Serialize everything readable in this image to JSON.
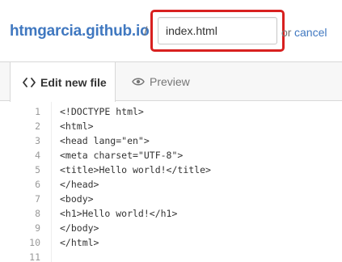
{
  "header": {
    "repo_name": "htmgarcia.github.io",
    "separator": "/",
    "filename_value": "index.html",
    "or_text": "or",
    "cancel_label": "cancel"
  },
  "tabs": [
    {
      "label": "Edit new file",
      "icon": "code-icon",
      "active": true
    },
    {
      "label": "Preview",
      "icon": "eye-icon",
      "active": false
    }
  ],
  "editor": {
    "line_numbers": [
      "1",
      "2",
      "3",
      "4",
      "5",
      "6",
      "7",
      "8",
      "9",
      "10",
      "11"
    ],
    "lines": [
      "<!DOCTYPE html>",
      "<html>",
      "<head lang=\"en\">",
      "<meta charset=\"UTF-8\">",
      "<title>Hello world!</title>",
      "</head>",
      "<body>",
      "<h1>Hello world!</h1>",
      "</body>",
      "</html>",
      ""
    ]
  },
  "colors": {
    "accent": "#4078c0",
    "highlight_border": "#d8201f"
  }
}
